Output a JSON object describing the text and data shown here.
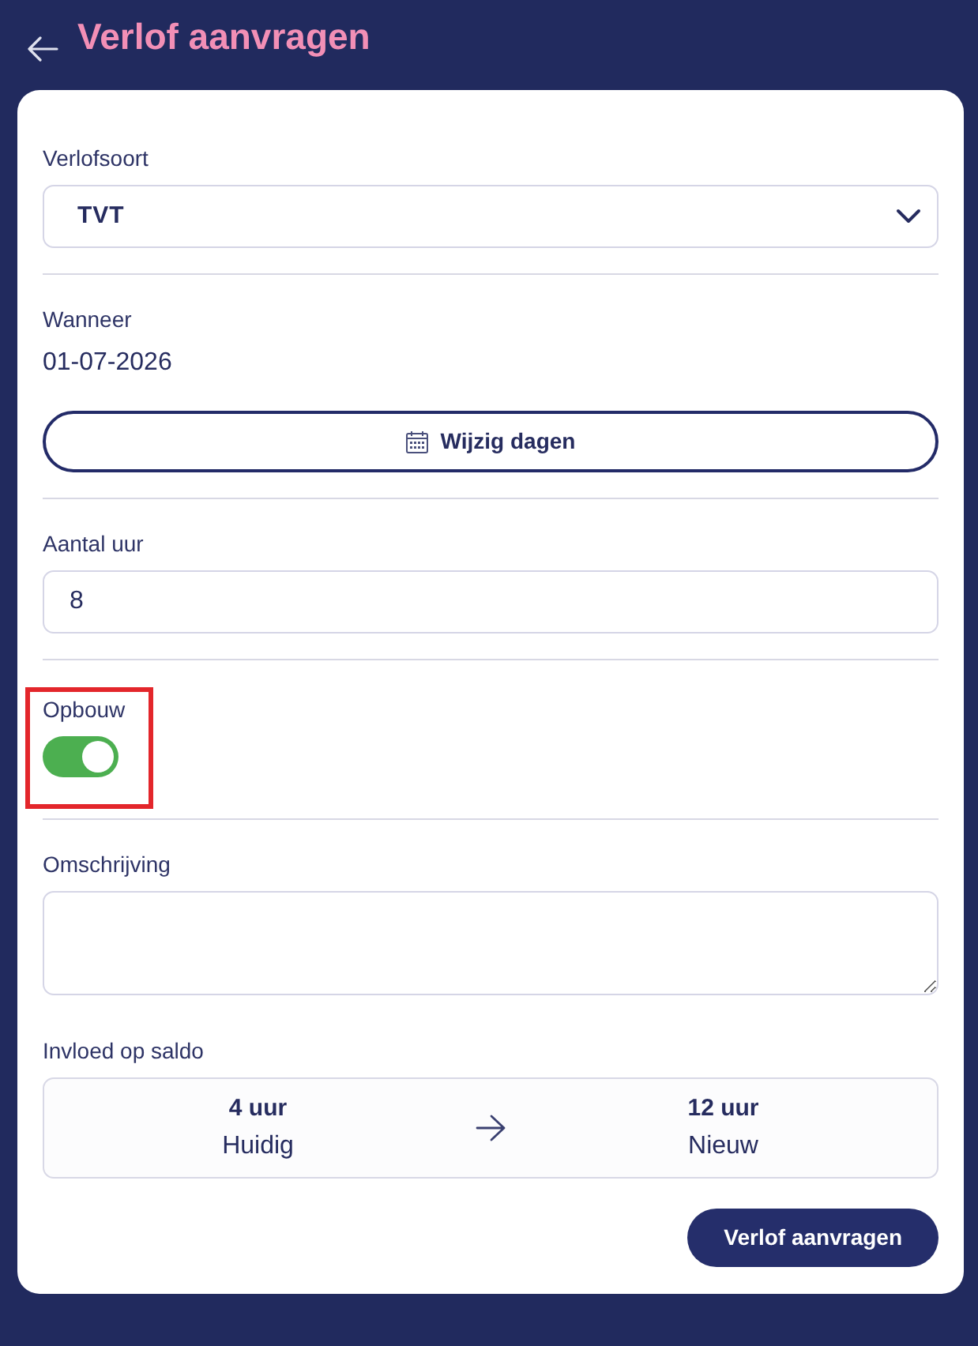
{
  "header": {
    "title": "Verlof aanvragen"
  },
  "sections": [
    {
      "fields": [
        {
          "kind": "select",
          "label": "Verlofsoort",
          "value": "TVT"
        }
      ]
    },
    {
      "fields": [
        {
          "kind": "date",
          "label": "Wanneer",
          "value": "01-07-2026",
          "button": "Wijzig dagen"
        }
      ]
    },
    {
      "fields": [
        {
          "kind": "input",
          "label": "Aantal uur",
          "value": "8"
        }
      ]
    },
    {
      "fields": [
        {
          "kind": "toggle",
          "label": "Opbouw",
          "on": true,
          "highlighted": true
        }
      ]
    },
    {
      "fields": [
        {
          "kind": "textarea",
          "label": "Omschrijving"
        },
        {
          "kind": "balance",
          "label": "Invloed op saldo",
          "current": {
            "value": "4 uur",
            "caption": "Huidig"
          },
          "new": {
            "value": "12 uur",
            "caption": "Nieuw"
          }
        }
      ]
    }
  ],
  "submit_button": "Verlof aanvragen"
}
